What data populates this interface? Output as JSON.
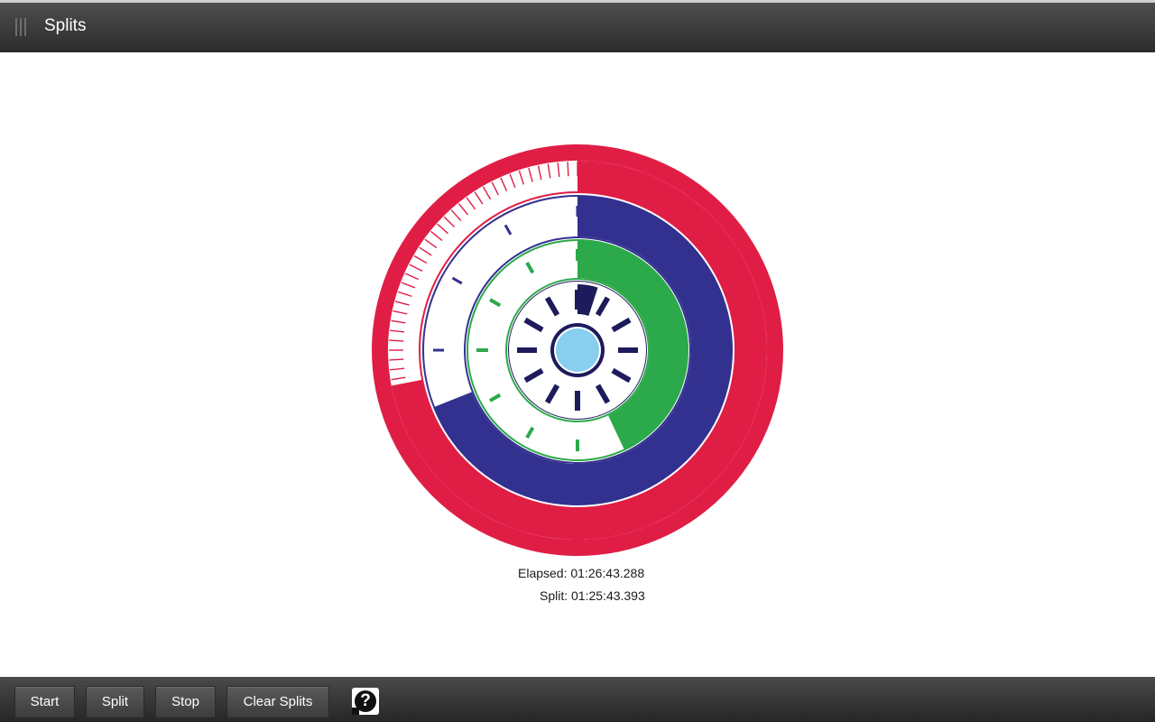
{
  "window": {
    "title": "Splits"
  },
  "readout": {
    "elapsed": "Elapsed: 01:26:43.288",
    "split": "Split: 01:25:43.393"
  },
  "toolbar": {
    "buttons": [
      {
        "label": "Start"
      },
      {
        "label": "Split"
      },
      {
        "label": "Stop"
      },
      {
        "label": "Clear Splits"
      }
    ],
    "help_icon": "question-mark-icon"
  },
  "dial": {
    "rings": [
      {
        "name": "outer",
        "color": "#E01E45",
        "progress": 0.72
      },
      {
        "name": "second",
        "color": "#333190",
        "progress": 0.69
      },
      {
        "name": "third",
        "color": "#2CA94A",
        "progress": 0.43
      },
      {
        "name": "inner",
        "color": "#1E1B5C",
        "progress": 0.05
      }
    ],
    "center_color": "#87CEEF"
  }
}
